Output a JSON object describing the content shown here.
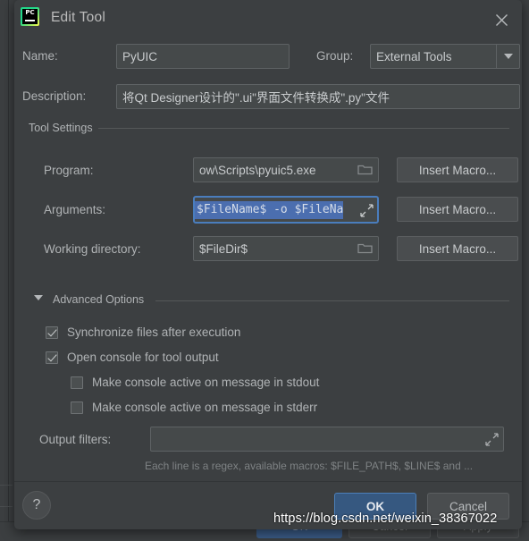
{
  "window": {
    "title": "Edit Tool",
    "icon": "pycharm-logo-icon",
    "close_icon": "close-icon"
  },
  "form": {
    "name_label": "Name:",
    "name_value": "PyUIC",
    "group_label": "Group:",
    "group_value": "External Tools",
    "group_arrow_icon": "chevron-down-icon",
    "description_label": "Description:",
    "description_value": "将Qt Designer设计的\".ui\"界面文件转换成\".py\"文件"
  },
  "tool_settings": {
    "legend": "Tool Settings",
    "program_label": "Program:",
    "program_value": "ow\\Scripts\\pyuic5.exe",
    "program_browse_icon": "folder-icon",
    "program_macro_button": "Insert Macro...",
    "arguments_label": "Arguments:",
    "arguments_value": "$FileName$ -o $FileNa",
    "arguments_expand_icon": "expand-icon",
    "arguments_macro_button": "Insert Macro...",
    "working_dir_label": "Working directory:",
    "working_dir_value": "$FileDir$",
    "working_dir_browse_icon": "folder-icon",
    "working_dir_macro_button": "Insert Macro..."
  },
  "advanced_options": {
    "header": "Advanced Options",
    "toggle_icon": "triangle-down-icon",
    "checkboxes": [
      {
        "label": "Synchronize files after execution",
        "checked": true
      },
      {
        "label": "Open console for tool output",
        "checked": true
      },
      {
        "label": "Make console active on message in stdout",
        "checked": false
      },
      {
        "label": "Make console active on message in stderr",
        "checked": false
      }
    ]
  },
  "output_filters": {
    "label": "Output filters:",
    "value": "",
    "expand_icon": "expand-icon",
    "hint": "Each line is a regex, available macros: $FILE_PATH$, $LINE$ and ..."
  },
  "footer": {
    "help_label": "?",
    "ok_label": "OK",
    "cancel_label": "Cancel"
  },
  "background_window": {
    "ok_label": "OK",
    "cancel_label": "Cancel",
    "apply_label": "Apply"
  },
  "watermark": {
    "text": "https://blog.csdn.net/weixin_38367022"
  },
  "colors": {
    "dialog_bg": "#3c3f41",
    "field_bg": "#45494a",
    "text": "#b0b3b5",
    "accent_blue": "#365880",
    "selection_blue": "#4b6eaf",
    "focus_border": "#4a7dbd"
  }
}
